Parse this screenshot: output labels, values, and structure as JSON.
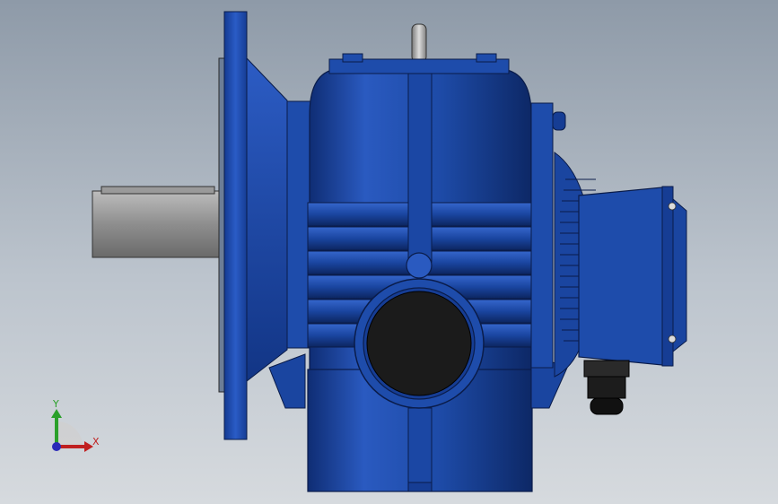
{
  "viewport": {
    "background_top": "#8e9aa8",
    "background_bottom": "#d6dade"
  },
  "model": {
    "body_color": "#1f4fae",
    "body_dark": "#0f2d74",
    "shaft_color": "#9a9a9a",
    "bore_color": "#1b1b1b",
    "gland_color": "#2a2a2a"
  },
  "triad": {
    "y_label": "Y",
    "x_label": "X",
    "y_color": "#2aa02a",
    "x_color": "#c02020",
    "z_color": "#2a2ab8"
  }
}
